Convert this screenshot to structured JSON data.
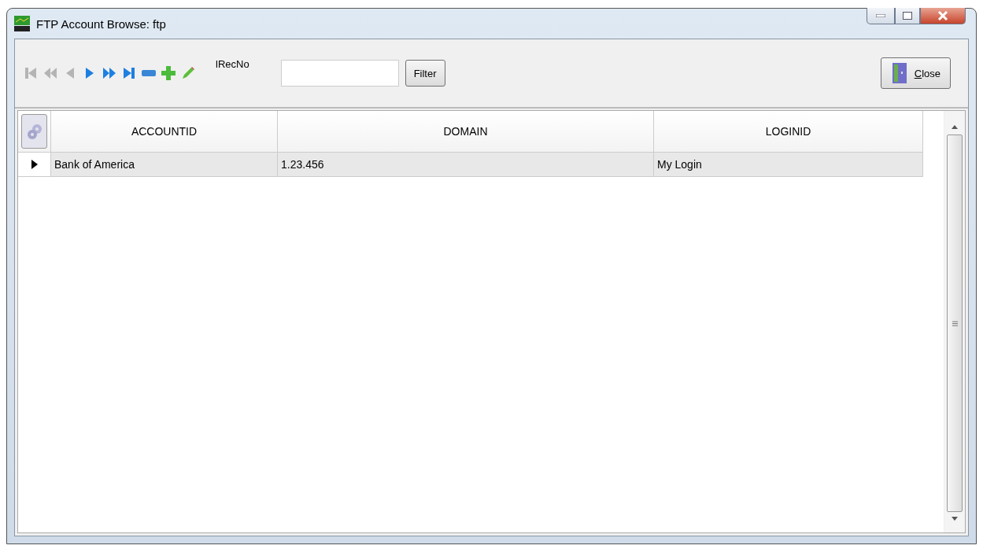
{
  "window": {
    "title": "FTP Account Browse: ftp"
  },
  "navigator": [
    {
      "kind": "first",
      "disabled": true
    },
    {
      "kind": "prior-page",
      "disabled": true
    },
    {
      "kind": "prior",
      "disabled": true
    },
    {
      "kind": "next",
      "disabled": false
    },
    {
      "kind": "next-page",
      "disabled": false
    },
    {
      "kind": "last",
      "disabled": false
    },
    {
      "kind": "delete",
      "disabled": false
    },
    {
      "kind": "insert",
      "disabled": false
    },
    {
      "kind": "edit",
      "disabled": false
    }
  ],
  "filter": {
    "label": "lRecNo",
    "button": "Filter"
  },
  "close_button": {
    "label": "Close",
    "mnemonic_underlined": true
  },
  "table": {
    "columns": [
      "ACCOUNTID",
      "DOMAIN",
      "LOGINID"
    ],
    "rows": [
      {
        "selected": true,
        "cells": [
          "Bank of America",
          "1.23.456",
          "My Login"
        ]
      }
    ]
  }
}
